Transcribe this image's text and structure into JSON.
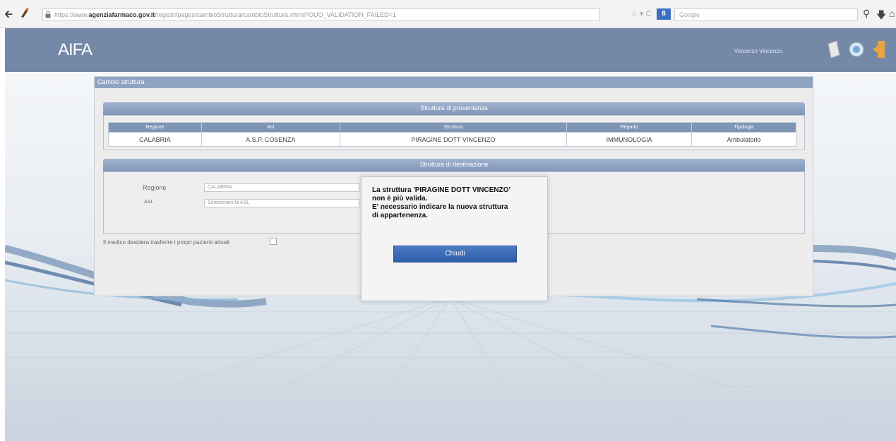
{
  "browser": {
    "url_prefix": "https://www.",
    "url_domain": "agenziafarmaco.gov.it",
    "url_path": "/registri/pages/cambioStruttura/cambioStruttura.xhtml?OUO_VALIDATION_FAILED=1",
    "search_engine_label": "8",
    "search_placeholder": "Google",
    "url_actions": "☆ ▾ C"
  },
  "header": {
    "logo_text": "AIFA",
    "user_name": "Vincenzo Vincenzo"
  },
  "panel": {
    "title": "Cambio struttura",
    "origin_section_title": "Struttura di provenienza",
    "origin_table": {
      "headers": [
        "Regione",
        "Asl",
        "Struttura",
        "Reparto",
        "Tipologia"
      ],
      "row": [
        "CALABRIA",
        "A.S.P. COSENZA",
        "PIRAGINE DOTT VINCENZO",
        "IMMUNOLOGIA",
        "Ambulatorio"
      ]
    },
    "destination_section_title": "Struttura di destinazione",
    "form": {
      "regione_label": "Regione",
      "regione_value": "CALABRIA",
      "asl_label": "ASL",
      "asl_value": "Selezionare la ASL"
    },
    "checkbox_label": "Il medico desidera trasferire i propri pazienti attuali"
  },
  "modal": {
    "line1": "La struttura 'PIRAGINE DOTT VINCENZO'",
    "line2": "non è più valida.",
    "line3": "E' necessario indicare la nuova struttura",
    "line4": "di appartenenza.",
    "button_label": "Chiudi"
  },
  "colors": {
    "header_bg": "#7489a8",
    "section_bar": "#8ea4c2",
    "button_primary": "#2c5da6"
  }
}
